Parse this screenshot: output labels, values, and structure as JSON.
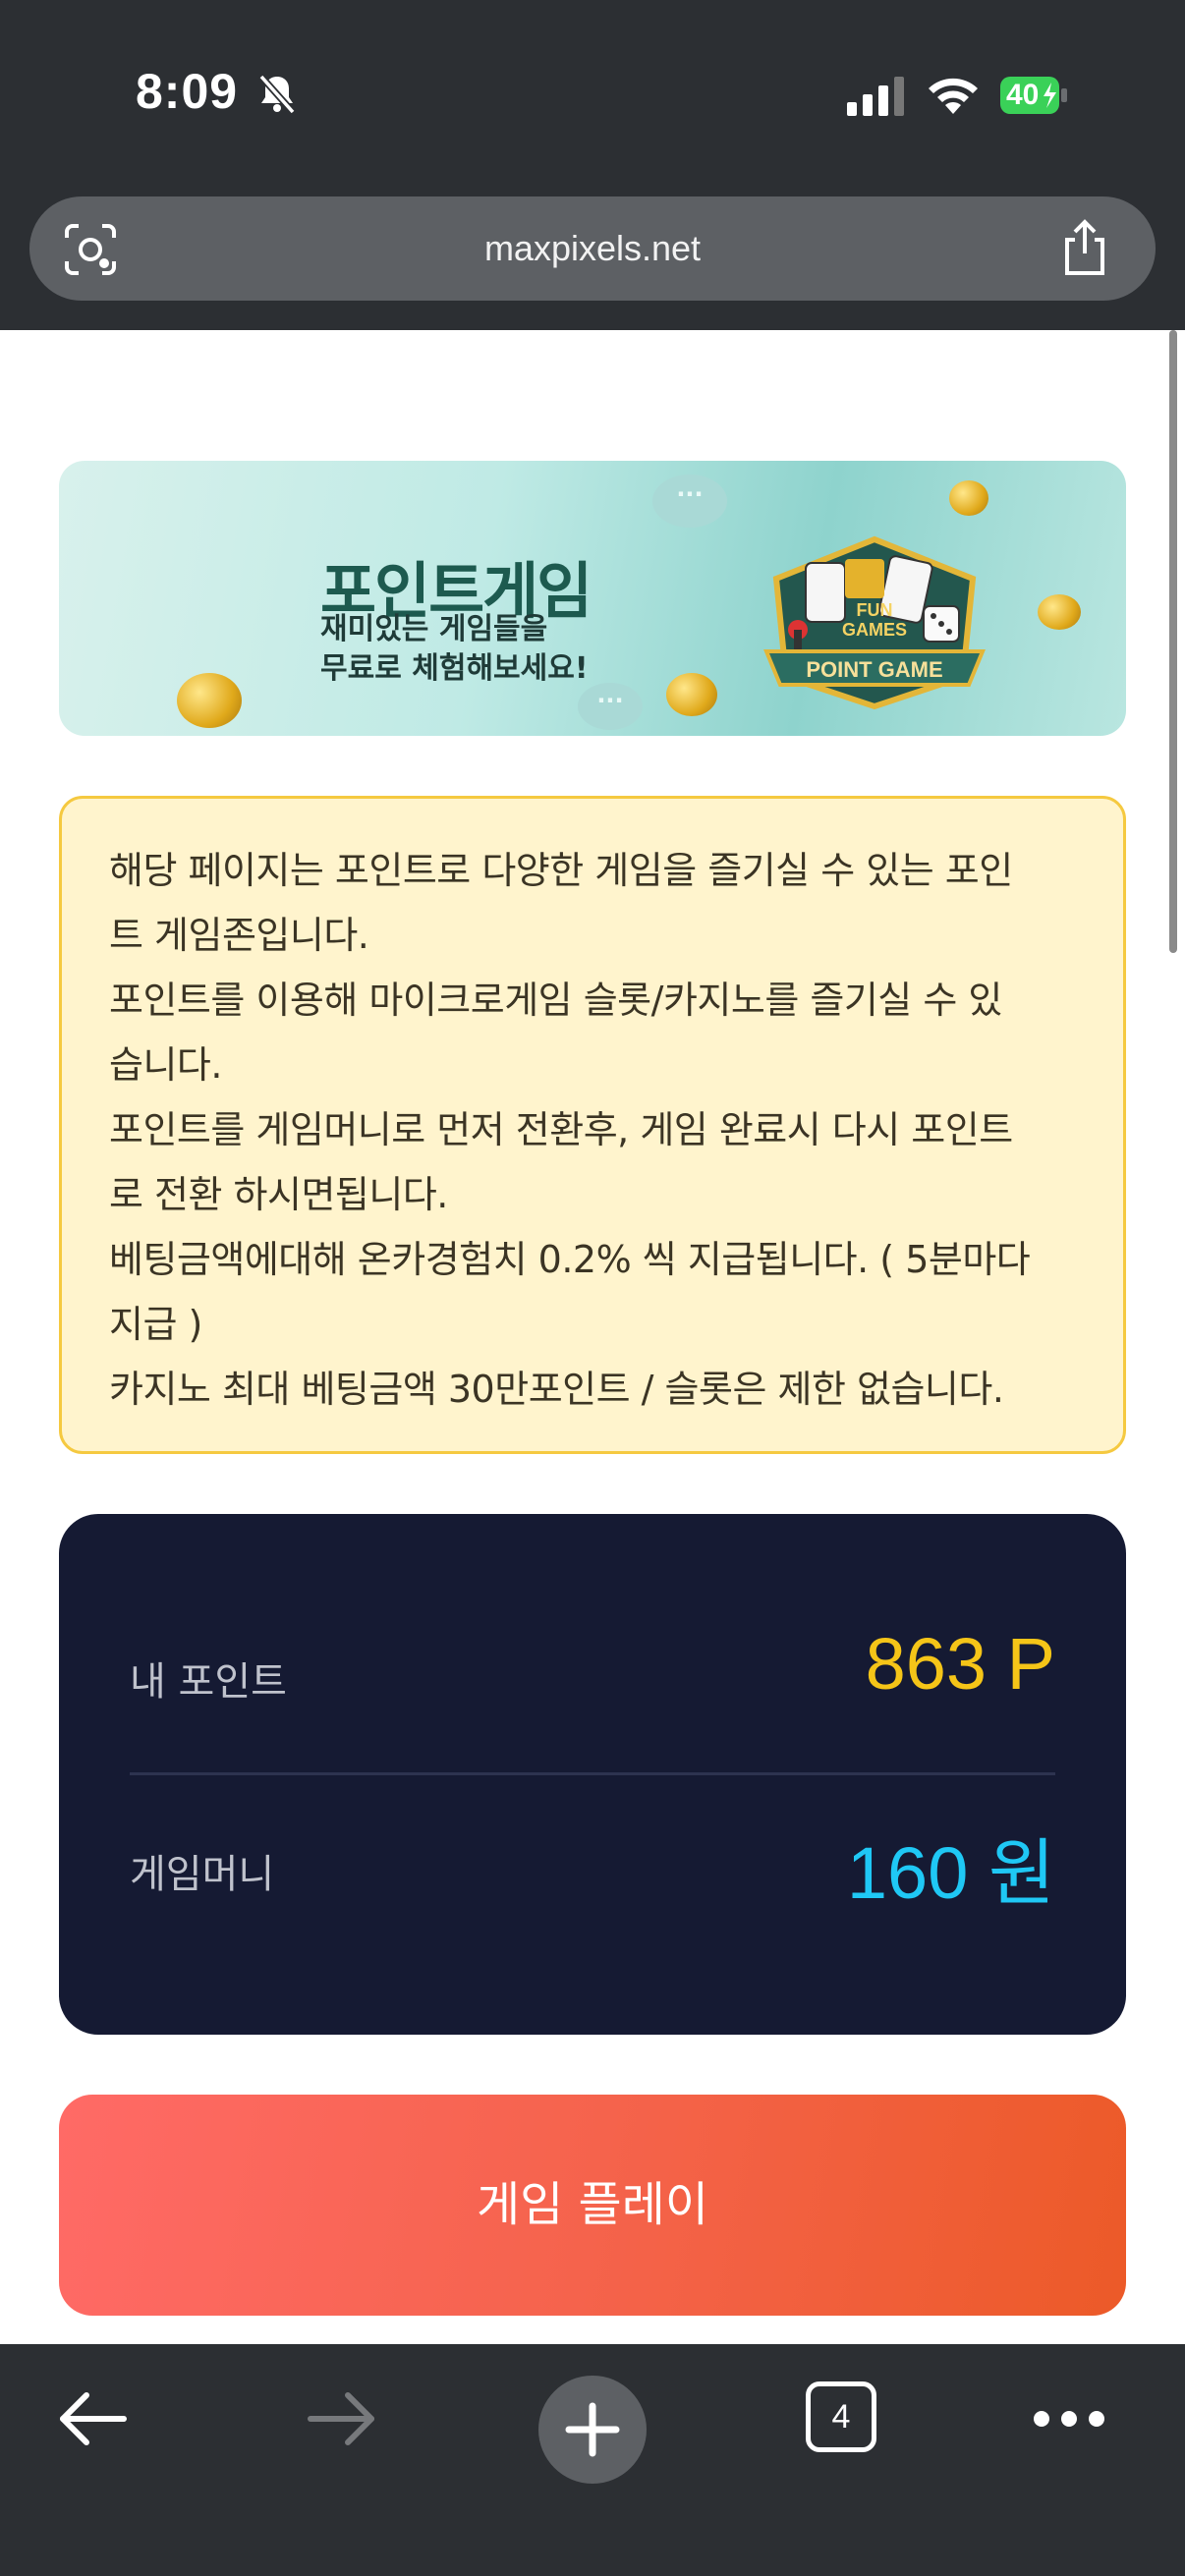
{
  "status_bar": {
    "time": "8:09",
    "battery": "40",
    "icons": [
      "bell-slash-icon",
      "signal-icon",
      "wifi-icon",
      "battery-charging-icon"
    ]
  },
  "browser": {
    "url": "maxpixels.net",
    "icons": [
      "lens-icon",
      "share-icon"
    ]
  },
  "banner": {
    "title": "포인트게임",
    "subtitle_line1": "재미있는 게임들을",
    "subtitle_line2": "무료로 체험해보세요!",
    "emblem_line1": "FUN",
    "emblem_line2": "GAMES",
    "emblem_ribbon": "POINT GAME",
    "bubble": "···"
  },
  "info": {
    "lines": [
      "해당 페이지는 포인트로 다양한 게임을 즐기실 수 있는 포인",
      "트 게임존입니다.",
      "포인트를 이용해 마이크로게임 슬롯/카지노를 즐기실 수 있",
      "습니다.",
      "포인트를 게임머니로 먼저 전환후, 게임 완료시 다시 포인트",
      "로 전환 하시면됩니다.",
      "베팅금액에대해 온카경험치 0.2% 씩 지급됩니다. ( 5분마다",
      "지급 )",
      "카지노 최대 베팅금액 30만포인트 / 슬롯은 제한 없습니다."
    ]
  },
  "points": {
    "my_points_label": "내 포인트",
    "my_points_value": "863 P",
    "game_money_label": "게임머니",
    "game_money_value": "160 원",
    "point_color": "#f5c518",
    "money_color": "#1fc8f5"
  },
  "play_button": {
    "label": "게임 플레이"
  },
  "bottom_nav": {
    "tab_count": "4",
    "icons": [
      "back-arrow-icon",
      "forward-arrow-icon",
      "plus-icon",
      "tabs-icon",
      "more-icon"
    ]
  }
}
